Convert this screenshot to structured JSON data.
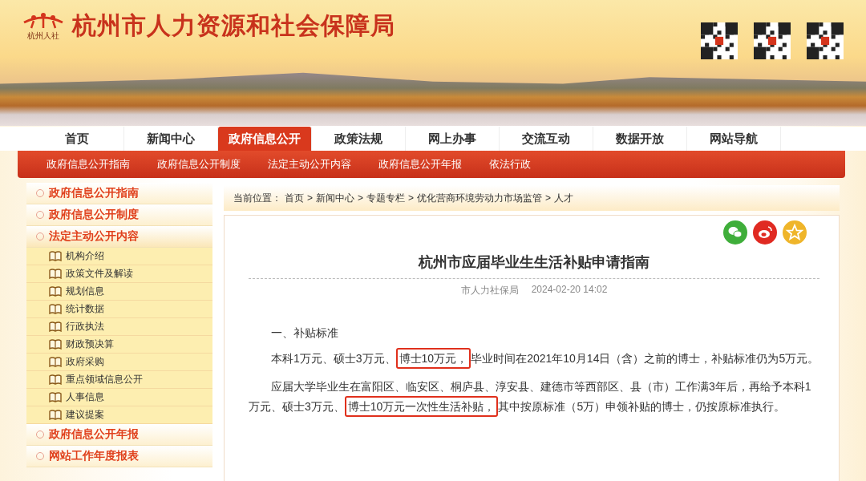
{
  "header": {
    "logo_text": "杭州人社",
    "site_title": "杭州市人力资源和社会保障局"
  },
  "nav": [
    {
      "label": "首页",
      "selected": false
    },
    {
      "label": "新闻中心",
      "selected": false
    },
    {
      "label": "政府信息公开",
      "selected": true
    },
    {
      "label": "政策法规",
      "selected": false
    },
    {
      "label": "网上办事",
      "selected": false
    },
    {
      "label": "交流互动",
      "selected": false
    },
    {
      "label": "数据开放",
      "selected": false
    },
    {
      "label": "网站导航",
      "selected": false
    }
  ],
  "subnav": [
    "政府信息公开指南",
    "政府信息公开制度",
    "法定主动公开内容",
    "政府信息公开年报",
    "依法行政"
  ],
  "sidebar": [
    {
      "label": "政府信息公开指南",
      "expanded": false
    },
    {
      "label": "政府信息公开制度",
      "expanded": false
    },
    {
      "label": "法定主动公开内容",
      "expanded": true,
      "children": [
        {
          "label": "机构介绍"
        },
        {
          "label": "政策文件及解读"
        },
        {
          "label": "规划信息"
        },
        {
          "label": "统计数据"
        },
        {
          "label": "行政执法"
        },
        {
          "label": "财政预决算"
        },
        {
          "label": "政府采购"
        },
        {
          "label": "重点领域信息公开"
        },
        {
          "label": "人事信息"
        },
        {
          "label": "建议提案"
        }
      ]
    },
    {
      "label": "政府信息公开年报",
      "expanded": false
    },
    {
      "label": "网站工作年度报表",
      "expanded": false
    }
  ],
  "breadcrumb": {
    "prefix": "当前位置：",
    "items": [
      "首页",
      "新闻中心",
      "专题专栏",
      "优化营商环境劳动力市场监管",
      "人才"
    ],
    "separator": ">"
  },
  "article": {
    "share": [
      {
        "kind": "wechat"
      },
      {
        "kind": "weibo"
      },
      {
        "kind": "favorite"
      }
    ],
    "title": "杭州市应届毕业生生活补贴申请指南",
    "source": "市人力社保局",
    "date": "2024-02-20 14:02",
    "heading": "一、补贴标准",
    "paragraphs": [
      {
        "segments": [
          {
            "text": "本科1万元、硕士3万元、",
            "highlighted": false
          },
          {
            "text": "博士10万元，",
            "highlighted": true
          },
          {
            "text": "毕业时间在2021年10月14日（含）之前的博士，补贴标准仍为5万元。",
            "highlighted": false
          }
        ]
      },
      {
        "segments": [
          {
            "text": "应届大学毕业生在富阳区、临安区、桐庐县、淳安县、建德市等西部区、县（市）工作满3年后，再给予本科1万元、硕士3万元、",
            "highlighted": false
          },
          {
            "text": "博士10万元一次性生活补贴，",
            "highlighted": true
          },
          {
            "text": "其中按原标准（5万）申领补贴的博士，仍按原标准执行。",
            "highlighted": false
          }
        ]
      }
    ]
  }
}
